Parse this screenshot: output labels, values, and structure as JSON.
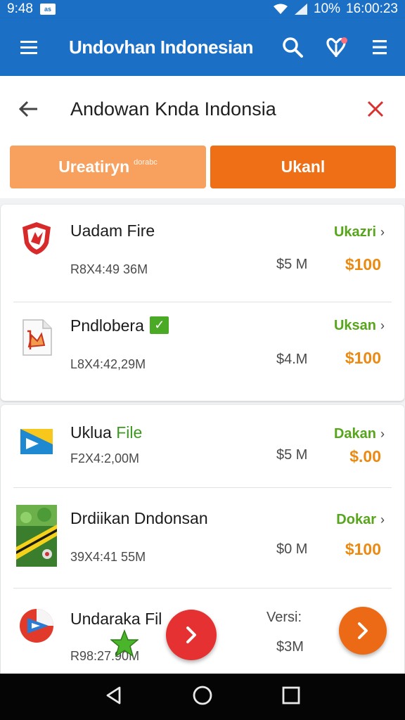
{
  "status_bar": {
    "time": "9:48",
    "badge": "as",
    "battery": "10%",
    "clock": "16:00:23"
  },
  "app_bar": {
    "title": "Undovhan Indonesian"
  },
  "search": {
    "query": "Andowan Knda Indonsia"
  },
  "tabs": [
    {
      "label": "Ureatiryn",
      "sub": "dorabc"
    },
    {
      "label": "Ukanl"
    }
  ],
  "items": [
    {
      "name": "Uadam Fire",
      "meta": "R8X4:49 36M",
      "size": "$5 M",
      "action": "Ukazri",
      "price": "$100"
    },
    {
      "name": "Pndlobera",
      "meta": "L8X4:42,29M",
      "size": "$4.M",
      "action": "Uksan",
      "price": "$100"
    },
    {
      "name": "Uklua",
      "name_highlight": "File",
      "meta": "F2X4:2,00M",
      "size": "$5 M",
      "action": "Dakan",
      "price": "$.00"
    },
    {
      "name": "Drdiikan Dndonsan",
      "meta": "39X4:41 55M",
      "size": "$0 M",
      "action": "Dokar",
      "price": "$100"
    },
    {
      "name": "Undaraka Fil",
      "meta": "R98:27.90M",
      "label": "Versi:",
      "size": "$3M"
    }
  ],
  "colors": {
    "primary": "#1b70c6",
    "tab_light": "#f8a05e",
    "tab_dark": "#ee6f16",
    "action_green": "#56a51b",
    "price_orange": "#ea8a12",
    "fab_red": "#e53131",
    "fab_orange": "#ec6a16"
  },
  "icons": [
    "menu-icon",
    "search-icon",
    "heart-pin-icon",
    "overflow-menu-icon",
    "back-arrow-icon",
    "close-icon",
    "shield-icon",
    "document-icon",
    "flag-icon",
    "game-thumbnail",
    "browser-icon",
    "star-icon",
    "arrow-right-icon",
    "nav-back-icon",
    "nav-home-icon",
    "nav-recents-icon"
  ]
}
